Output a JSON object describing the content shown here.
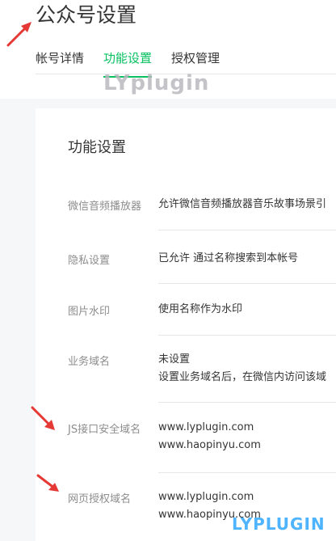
{
  "header": {
    "title": "公众号设置",
    "tabs": [
      {
        "label": "帐号详情",
        "active": false
      },
      {
        "label": "功能设置",
        "active": true
      },
      {
        "label": "授权管理",
        "active": false
      }
    ]
  },
  "watermarks": {
    "top": "LYplugin",
    "bottom": "LYPLUGIN"
  },
  "section": {
    "title": "功能设置",
    "rows": [
      {
        "label": "微信音频播放器",
        "values": [
          "允许微信音频播放器音乐故事场景引"
        ]
      },
      {
        "label": "隐私设置",
        "values": [
          "已允许 通过名称搜索到本帐号"
        ]
      },
      {
        "label": "图片水印",
        "values": [
          "使用名称作为水印"
        ]
      },
      {
        "label": "业务域名",
        "values": [
          "未设置",
          "设置业务域名后，在微信内访问该域"
        ]
      },
      {
        "label": "JS接口安全域名",
        "values": [
          "www.lyplugin.com",
          "www.haopinyu.com"
        ]
      },
      {
        "label": "网页授权域名",
        "values": [
          "www.lyplugin.com",
          "www.haopinyu.com"
        ]
      }
    ]
  },
  "colors": {
    "accent": "#07c160",
    "annotation_arrow": "#e53935",
    "watermark_blue": "#4fb4ff"
  }
}
